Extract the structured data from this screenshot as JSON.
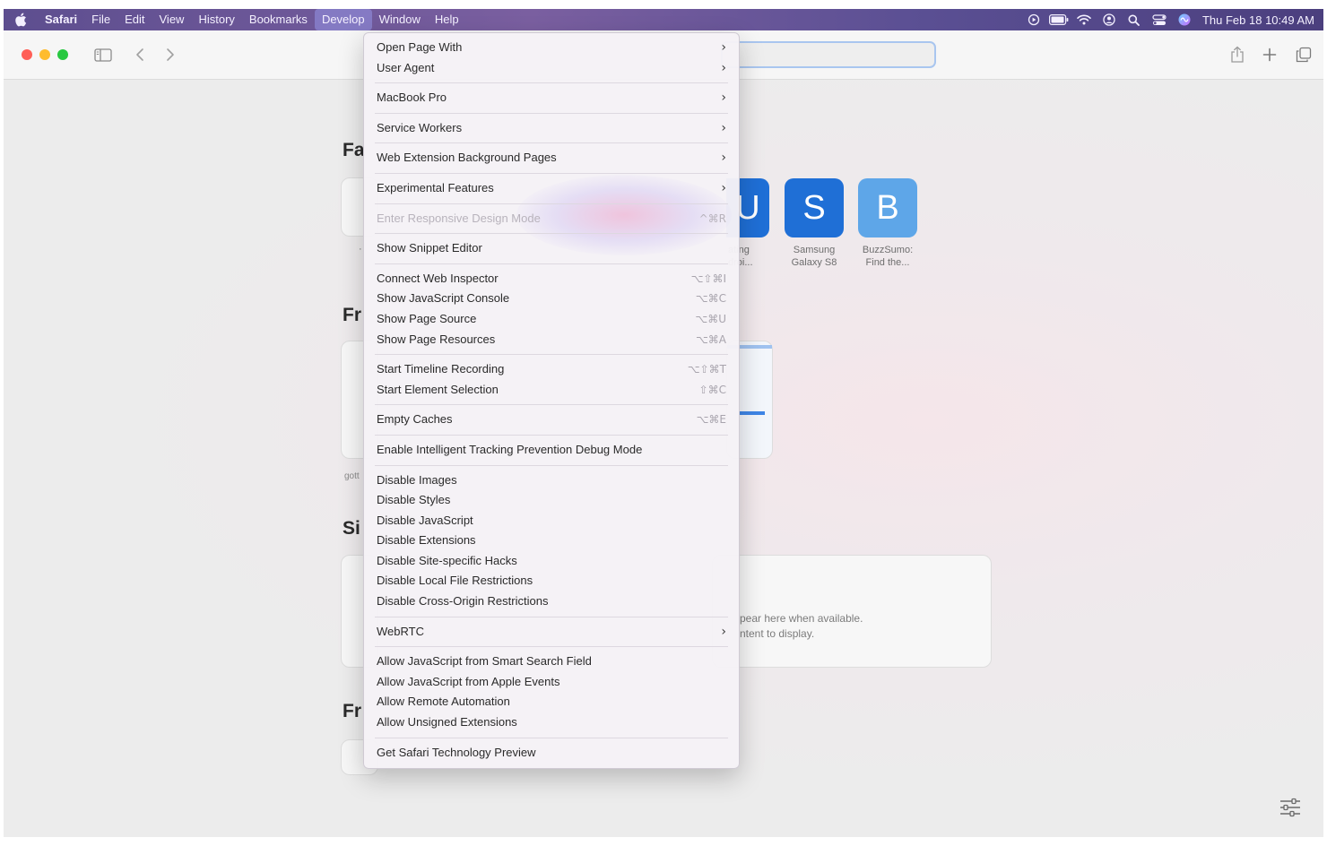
{
  "menubar": {
    "app": "Safari",
    "items": [
      "File",
      "Edit",
      "View",
      "History",
      "Bookmarks",
      "Develop",
      "Window",
      "Help"
    ],
    "active": "Develop",
    "clock": "Thu Feb 18  10:49 AM"
  },
  "colors": {
    "close": "#ff5f57",
    "minimize": "#febc2e",
    "zoom": "#28c840",
    "tile_blue": "#1f6fd6",
    "tile_lightblue": "#5ea6e8"
  },
  "icons": {
    "apple": "apple-icon",
    "sidebar": "sidebar-icon",
    "back": "chevron-left-icon",
    "forward": "chevron-right-icon",
    "share": "share-icon",
    "new_tab": "plus-icon",
    "tab_overview": "tabs-icon",
    "customize": "sliders-icon"
  },
  "page": {
    "favorites_heading": "Fa",
    "frequent_heading": "Fr",
    "siri_heading": "Si",
    "reading_heading": "Fr",
    "partial_tile": "U",
    "partial_caption": [
      "ating",
      "droi..."
    ],
    "tiles": [
      {
        "letter": "S",
        "caption": [
          "Samsung",
          "Galaxy S8"
        ]
      },
      {
        "letter": "B",
        "caption": [
          "BuzzSumo:",
          "Find the..."
        ]
      }
    ],
    "frequent_caption": "gott",
    "siri_empty": [
      "pear here when available.",
      "ntent to display."
    ]
  },
  "develop_menu": {
    "groups": [
      [
        {
          "label": "Open Page With",
          "submenu": true
        },
        {
          "label": "User Agent",
          "submenu": true
        }
      ],
      [
        {
          "label": "MacBook Pro",
          "submenu": true
        }
      ],
      [
        {
          "label": "Service Workers",
          "submenu": true
        }
      ],
      [
        {
          "label": "Web Extension Background Pages",
          "submenu": true
        }
      ],
      [
        {
          "label": "Experimental Features",
          "submenu": true
        }
      ],
      [
        {
          "label": "Enter Responsive Design Mode",
          "shortcut": "^⌘R",
          "disabled": true
        }
      ],
      [
        {
          "label": "Show Snippet Editor"
        }
      ],
      [
        {
          "label": "Connect Web Inspector",
          "shortcut": "⌥⇧⌘I"
        },
        {
          "label": "Show JavaScript Console",
          "shortcut": "⌥⌘C"
        },
        {
          "label": "Show Page Source",
          "shortcut": "⌥⌘U"
        },
        {
          "label": "Show Page Resources",
          "shortcut": "⌥⌘A"
        }
      ],
      [
        {
          "label": "Start Timeline Recording",
          "shortcut": "⌥⇧⌘T"
        },
        {
          "label": "Start Element Selection",
          "shortcut": "⇧⌘C"
        }
      ],
      [
        {
          "label": "Empty Caches",
          "shortcut": "⌥⌘E"
        }
      ],
      [
        {
          "label": "Enable Intelligent Tracking Prevention Debug Mode"
        }
      ],
      [
        {
          "label": "Disable Images"
        },
        {
          "label": "Disable Styles"
        },
        {
          "label": "Disable JavaScript"
        },
        {
          "label": "Disable Extensions"
        },
        {
          "label": "Disable Site-specific Hacks"
        },
        {
          "label": "Disable Local File Restrictions"
        },
        {
          "label": "Disable Cross-Origin Restrictions"
        }
      ],
      [
        {
          "label": "WebRTC",
          "submenu": true
        }
      ],
      [
        {
          "label": "Allow JavaScript from Smart Search Field"
        },
        {
          "label": "Allow JavaScript from Apple Events"
        },
        {
          "label": "Allow Remote Automation"
        },
        {
          "label": "Allow Unsigned Extensions"
        }
      ],
      [
        {
          "label": "Get Safari Technology Preview"
        }
      ]
    ]
  }
}
